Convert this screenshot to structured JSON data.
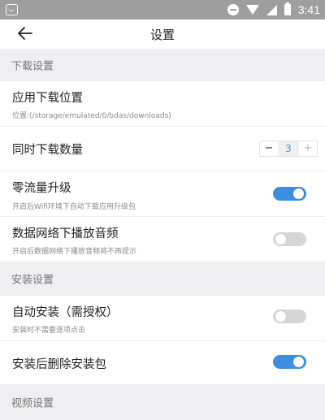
{
  "status_bar": {
    "time": "3:41"
  },
  "header": {
    "title": "设置"
  },
  "sections": {
    "download": {
      "label": "下载设置"
    },
    "install": {
      "label": "安装设置"
    },
    "video": {
      "label": "视频设置"
    }
  },
  "items": {
    "download_location": {
      "title": "应用下载位置",
      "subtitle": "位置:(/storage/emulated/0/bdas/downloads)"
    },
    "concurrent_downloads": {
      "title": "同时下载数量",
      "minus": "−",
      "value": "3",
      "plus": "+"
    },
    "zero_data_upgrade": {
      "title": "零流量升级",
      "subtitle": "开启后Wifi环境下自动下载应用升级包",
      "enabled": true
    },
    "mobile_audio": {
      "title": "数据网络下播放音频",
      "subtitle": "开启后数据网络下播放音频将不再提示",
      "enabled": false
    },
    "auto_install": {
      "title": "自动安装（需授权）",
      "subtitle": "安装时不需要逐项点击",
      "enabled": false
    },
    "delete_after_install": {
      "title": "安装后删除安装包",
      "enabled": true
    }
  },
  "colors": {
    "accent": "#3d8ee3",
    "toggle_off": "#d6d6d6",
    "section_bg": "#efeff1",
    "status_bar": "#9e9e9e"
  }
}
